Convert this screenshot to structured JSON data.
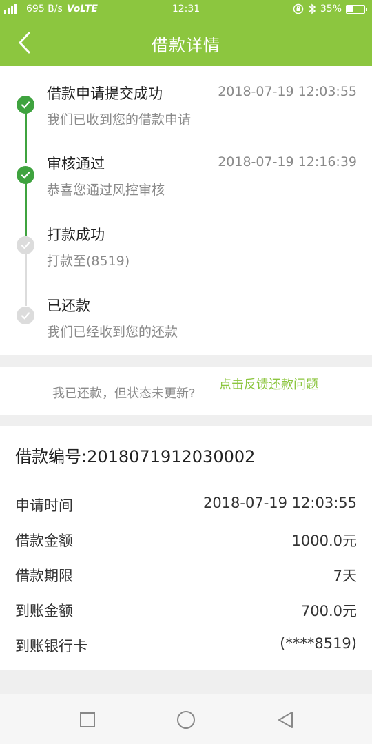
{
  "status_bar": {
    "network": "695 B/s",
    "volte": "VoLTE",
    "time": "12:31",
    "battery": "35%",
    "battery_level": 0.35
  },
  "header": {
    "title": "借款详情"
  },
  "timeline": [
    {
      "title": "借款申请提交成功",
      "subtitle": "我们已收到您的借款申请",
      "time": "2018-07-19 12:03:55",
      "done": true
    },
    {
      "title": "审核通过",
      "subtitle": "恭喜您通过风控审核",
      "time": "2018-07-19 12:16:39",
      "done": true
    },
    {
      "title": "打款成功",
      "subtitle": "打款至(8519)",
      "time": "",
      "done": false
    },
    {
      "title": "已还款",
      "subtitle": "我们已经收到您的还款",
      "time": "",
      "done": false
    }
  ],
  "feedback": {
    "question": "我已还款，但状态未更新?",
    "link": "点击反馈还款问题"
  },
  "details": {
    "loan_no": "借款编号:2018071912030002",
    "rows": [
      {
        "label": "申请时间",
        "value": "2018-07-19 12:03:55"
      },
      {
        "label": "借款金额",
        "value": "1000.0元"
      },
      {
        "label": "借款期限",
        "value": "7天"
      },
      {
        "label": "到账金额",
        "value": "700.0元"
      },
      {
        "label": "到账银行卡",
        "value": "(****8519)"
      }
    ]
  },
  "colors": {
    "accent": "#8cc63f",
    "done": "#3fa33f",
    "pending": "#dcdcdc"
  }
}
